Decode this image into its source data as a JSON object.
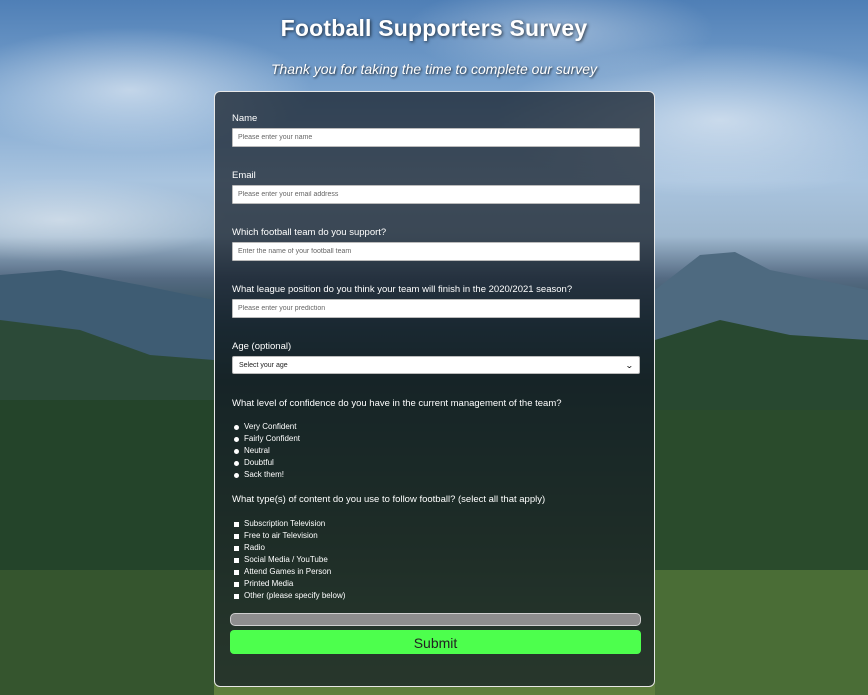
{
  "header": {
    "title": "Football Supporters Survey",
    "subtitle": "Thank you for taking the time to complete our survey"
  },
  "form": {
    "name": {
      "label": "Name",
      "placeholder": "Please enter your name"
    },
    "email": {
      "label": "Email",
      "placeholder": "Please enter your email address"
    },
    "team": {
      "label": "Which football team do you support?",
      "placeholder": "Enter the name of your football team"
    },
    "league_position": {
      "label": "What league position do you think your team will finish in the 2020/2021 season?",
      "placeholder": "Please enter your prediction"
    },
    "age": {
      "label": "Age (optional)",
      "selected": "Select your age"
    },
    "confidence": {
      "label": "What level of confidence do you have in the current management of the team?",
      "options": [
        "Very Confident",
        "Fairly Confident",
        "Neutral",
        "Doubtful",
        "Sack them!"
      ]
    },
    "content": {
      "label": "What type(s) of content do you use to follow football? (select all that apply)",
      "options": [
        "Subscription Television",
        "Free to air Television",
        "Radio",
        "Social Media / YouTube",
        "Attend Games in Person",
        "Printed Media",
        "Other (please specify below)"
      ]
    },
    "submit_label": "Submit"
  },
  "colors": {
    "submit_background": "#4dff4d",
    "form_background": "rgba(20, 28, 38, 0.72)"
  }
}
